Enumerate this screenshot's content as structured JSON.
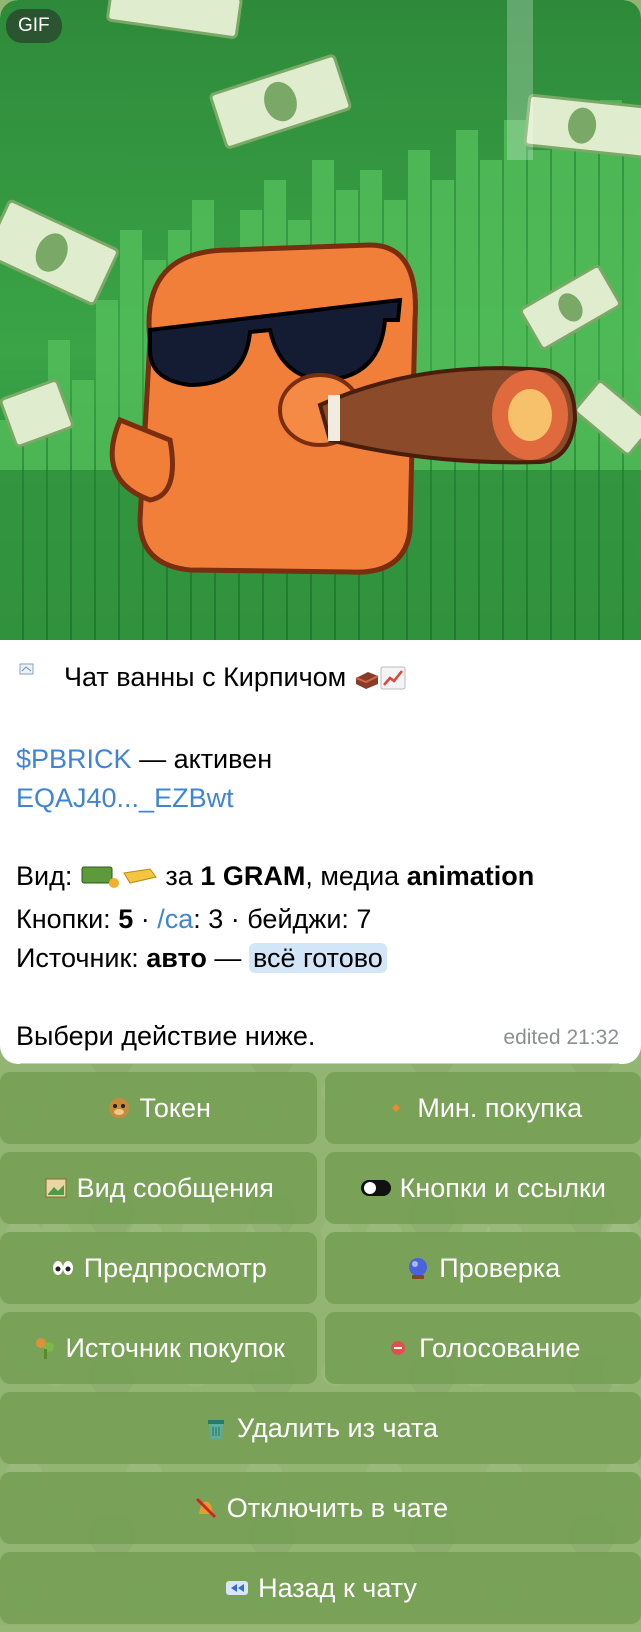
{
  "media": {
    "badge": "GIF"
  },
  "message": {
    "title": "Чат ванны с Кирпичом",
    "token_ticker": "$PBRICK",
    "token_status": "— активен",
    "address": "EQAJ40..._EZBwt",
    "view_label": "Вид:",
    "view_price_prefix": "за",
    "view_price": "1 GRAM",
    "view_media_prefix": ", медиа",
    "view_media": "animation",
    "buttons_label": "Кнопки:",
    "buttons_count": "5",
    "ca_link": "/ca",
    "ca_count": ": 3 · бейджи: 7",
    "source_label": "Источник:",
    "source_value": "авто",
    "source_dash": "—",
    "source_status": "всё готово",
    "prompt": "Выбери действие ниже.",
    "edited": "edited 21:32"
  },
  "buttons": {
    "token": "Токен",
    "min_buy": "Мин. покупка",
    "message_view": "Вид сообщения",
    "buttons_links": "Кнопки и ссылки",
    "preview": "Предпросмотр",
    "check": "Проверка",
    "buy_source": "Источник покупок",
    "voting": "Голосование",
    "remove_from_chat": "Удалить из чата",
    "disable_in_chat": "Отключить в чате",
    "back_to_chat": "Назад к чату"
  }
}
